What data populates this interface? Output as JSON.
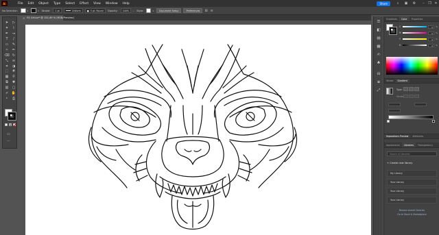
{
  "app": {
    "logo": "Ai",
    "menus": [
      "File",
      "Edit",
      "Object",
      "Type",
      "Select",
      "Effect",
      "View",
      "Window",
      "Help"
    ],
    "share_label": "Share",
    "window_controls": [
      "–",
      "❐",
      "✕"
    ]
  },
  "control_bar": {
    "selection_label": "No Selection",
    "stroke_label": "Stroke:",
    "stroke_value": "1 pt",
    "uniform_label": "Uniform",
    "brush_label": "5 pt. Round",
    "opacity_label": "Opacity:",
    "opacity_value": "100%",
    "style_label": "Style:",
    "doc_setup_label": "Document Setup",
    "preferences_label": "Preferences"
  },
  "document": {
    "tab_title": "R1 ArtLar* @ 152.49 % (RGB/Preview)"
  },
  "toolbar": {
    "tools": [
      "selection-tool",
      "direct-selection-tool",
      "magic-wand-tool",
      "lasso-tool",
      "pen-tool",
      "curvature-tool",
      "type-tool",
      "line-tool",
      "rectangle-tool",
      "paintbrush-tool",
      "shaper-tool",
      "pencil-tool",
      "eraser-tool",
      "rotate-tool",
      "scale-tool",
      "width-tool",
      "free-transform-tool",
      "shape-builder-tool",
      "perspective-tool",
      "mesh-tool",
      "gradient-tool",
      "eyedropper-tool",
      "blend-tool",
      "symbol-sprayer-tool",
      "graph-tool",
      "artboard-tool",
      "slice-tool",
      "hand-tool",
      "zoom-tool",
      "print-tiling-tool"
    ],
    "tool_glyphs": [
      "➤",
      "▷",
      "✦",
      "⌇",
      "✒",
      "↝",
      "T",
      "/",
      "▭",
      "✎",
      "✧",
      "✏",
      "⌫",
      "↻",
      "⤡",
      "≋",
      "⌗",
      "◑",
      "⬚",
      "#",
      "▦",
      "⚲",
      "⧉",
      "✺",
      "▥",
      "▢",
      "⌿",
      "✋",
      "⚬",
      "⎙"
    ],
    "more_label": "···"
  },
  "panel": {
    "color_tabs": [
      "Gradients",
      "Color",
      "Properties"
    ],
    "active_color_tab": "Color",
    "sliders": [
      {
        "label": "C",
        "value": "0"
      },
      {
        "label": "M",
        "value": "0"
      },
      {
        "label": "Y",
        "value": "0"
      },
      {
        "label": "K",
        "value": "0"
      }
    ],
    "percent": "%",
    "gradient_tabs": [
      "Stroke",
      "Gradient"
    ],
    "gradient_type_label": "Type:",
    "gradient_stroke_label": "Stroke:",
    "separations_tabs": [
      "Separations Preview",
      "Attributes"
    ],
    "library_tabs": [
      "Appearance",
      "Libraries",
      "Transparency"
    ],
    "active_library_tab": "Libraries",
    "search_placeholder": "Search all libraries",
    "create_library": "+ Create new library",
    "libraries": [
      "My Library",
      "Your Library",
      "Your Library",
      "Your Library"
    ],
    "links": [
      "Browse shared libraries",
      "Go to Stock & Marketplace"
    ]
  },
  "colors": {
    "accent": "#1473e6",
    "chrome_dark": "#323232",
    "chrome": "#424242",
    "canvas_bg": "#535353",
    "artboard": "#ffffff"
  }
}
